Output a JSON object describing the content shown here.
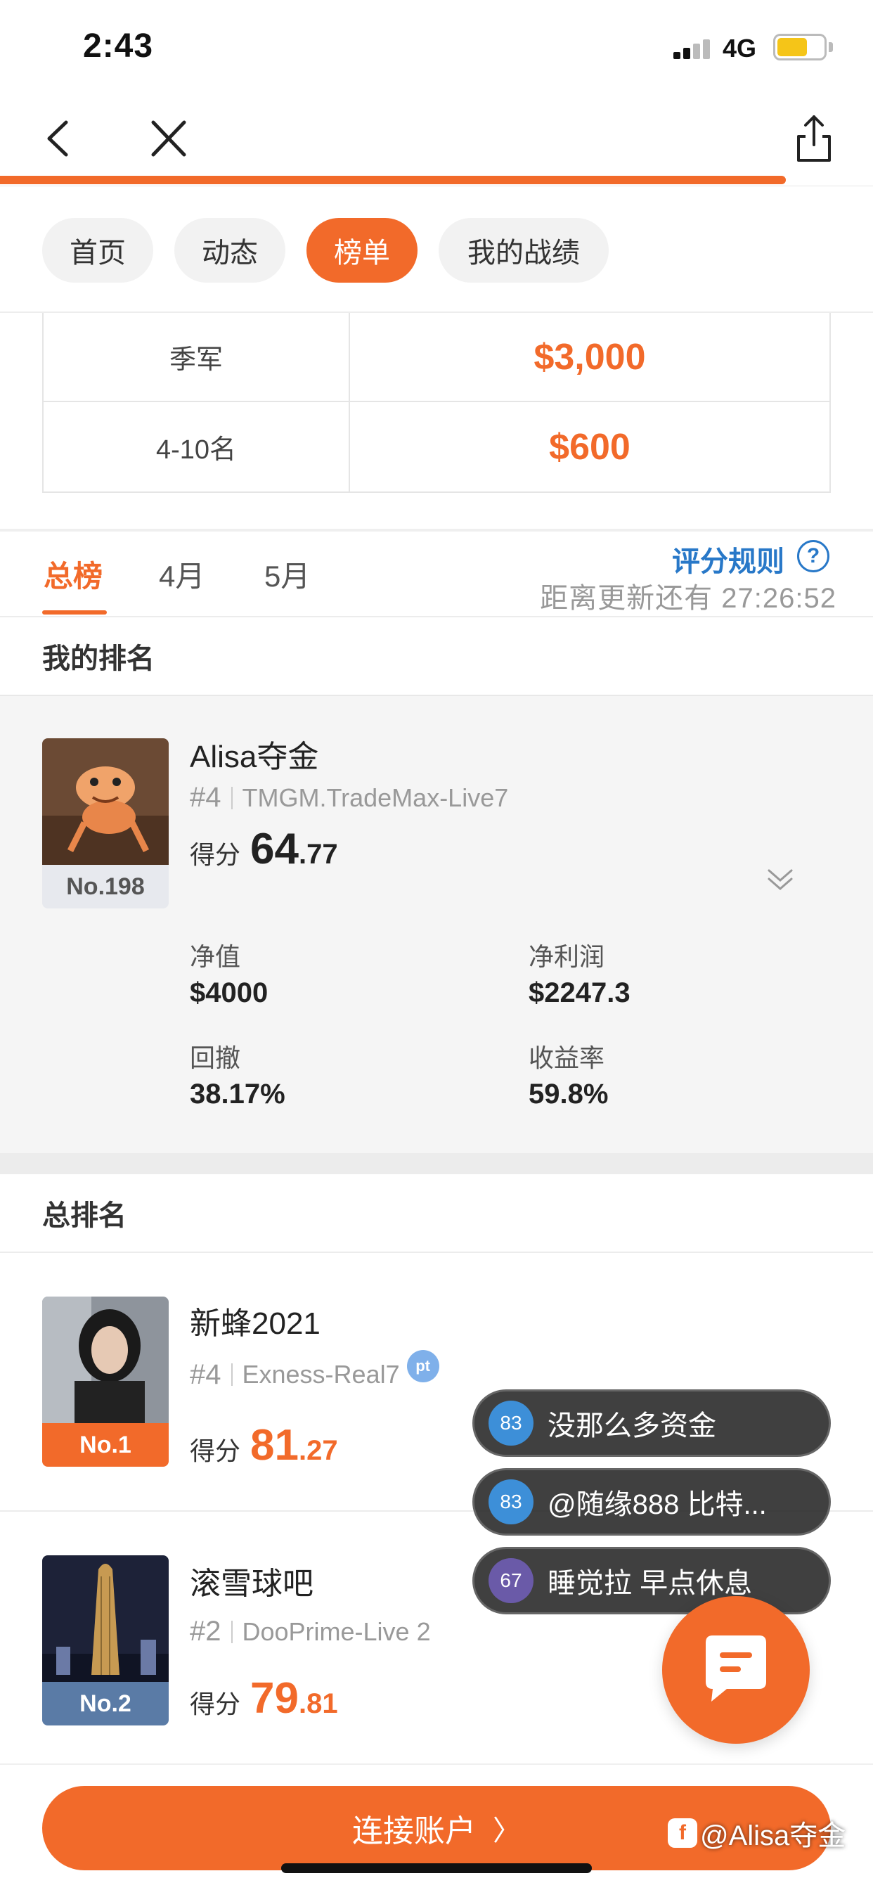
{
  "status_bar": {
    "time": "2:43",
    "network": "4G"
  },
  "progress": {
    "fraction": 0.9
  },
  "pill_tabs": [
    {
      "label": "首页",
      "active": false
    },
    {
      "label": "动态",
      "active": false
    },
    {
      "label": "榜单",
      "active": true
    },
    {
      "label": "我的战绩",
      "active": false
    }
  ],
  "prize_table": [
    {
      "rank": "季军",
      "amount": "$3,000"
    },
    {
      "rank": "4-10名",
      "amount": "$600"
    }
  ],
  "period_tabs": [
    {
      "label": "总榜",
      "active": true
    },
    {
      "label": "4月",
      "active": false
    },
    {
      "label": "5月",
      "active": false
    }
  ],
  "rules_link": "评分规则",
  "rules_icon": "?",
  "countdown": "距离更新还有 27:26:52",
  "my_rank": {
    "section_title": "我的排名",
    "name": "Alisa夺金",
    "rank_no": "No.198",
    "position": "#4",
    "account": "TMGM.TradeMax-Live7",
    "score_label": "得分",
    "score_int": "64",
    "score_dec": ".77",
    "stats": {
      "equity_label": "净值",
      "equity": "$4000",
      "profit_label": "净利润",
      "profit": "$2247.3",
      "drawdown_label": "回撤",
      "drawdown": "38.17%",
      "return_label": "收益率",
      "return": "59.8%"
    }
  },
  "overall": {
    "section_title": "总排名",
    "entries": [
      {
        "name": "新蜂2021",
        "rank_no": "No.1",
        "position": "#4",
        "account": "Exness-Real7",
        "badge": "pt",
        "score_label": "得分",
        "score_int": "81",
        "score_dec": ".27"
      },
      {
        "name": "滚雪球吧",
        "rank_no": "No.2",
        "position": "#2",
        "account": "DooPrime-Live 2",
        "score_label": "得分",
        "score_int": "79",
        "score_dec": ".81"
      }
    ]
  },
  "bubbles": [
    {
      "level": "83",
      "text": "没那么多资金",
      "color": "#3d8fd8"
    },
    {
      "level": "83",
      "text": "@随缘888 比特...",
      "color": "#3d8fd8"
    },
    {
      "level": "67",
      "text": "睡觉拉 早点休息",
      "color": "#6a5aa8"
    }
  ],
  "bottom": {
    "connect_label": "连接账户",
    "arrow": "〉"
  },
  "watermark": {
    "icon": "f",
    "text": "@Alisa夺金"
  },
  "icons": {
    "back": "chevron-left-icon",
    "close": "close-icon",
    "share": "share-icon",
    "chat": "chat-icon",
    "expand": "chevron-down-icon"
  },
  "colors": {
    "accent": "#f26a2a",
    "link": "#2878c8"
  }
}
